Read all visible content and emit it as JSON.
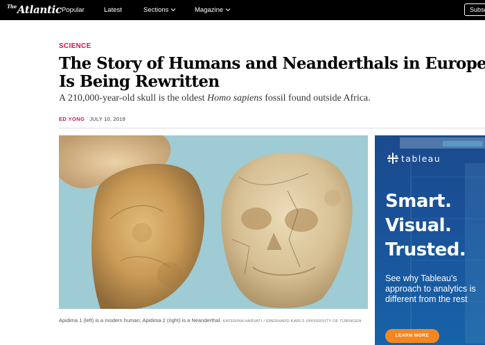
{
  "nav": {
    "logo_small": "The",
    "logo_main": "Atlantic",
    "items": [
      {
        "label": "Popular"
      },
      {
        "label": "Latest"
      },
      {
        "label": "Sections"
      },
      {
        "label": "Magazine"
      }
    ],
    "subscribe_label": "Subscribe"
  },
  "article": {
    "section": "SCIENCE",
    "headline": "The Story of Humans and Neanderthals in Europe Is Being Rewritten",
    "dek_before": "A 210,000-year-old skull is the oldest ",
    "dek_italic": "Homo sapiens",
    "dek_after": " fossil found outside Africa.",
    "author": "ED YONG",
    "date": "JULY 10, 2019",
    "caption": "Apidima 1 (left) is a modern human; Apidima 2 (right) is a Neanderthal.",
    "credit": "KATERINA HARVATI / EBERHARD KARLS UNIVERSITY OF TÜBINGEN"
  },
  "ad": {
    "brand": "tableau",
    "headline_lines": [
      "Smart.",
      "Visual.",
      "Trusted."
    ],
    "body": "See why Tableau's approach to analytics is different from the rest",
    "cta": "LEARN MORE"
  },
  "colors": {
    "nav_bg": "#000000",
    "accent": "#d1124e",
    "image_bg": "#9ecbd4",
    "ad_bg": "#1a5198",
    "ad_cta": "#f5871f"
  },
  "icons": {
    "sections_chevron": "chevron-down-icon",
    "magazine_chevron": "chevron-down-icon",
    "ad_logo_mark": "tableau-cross-icon"
  }
}
